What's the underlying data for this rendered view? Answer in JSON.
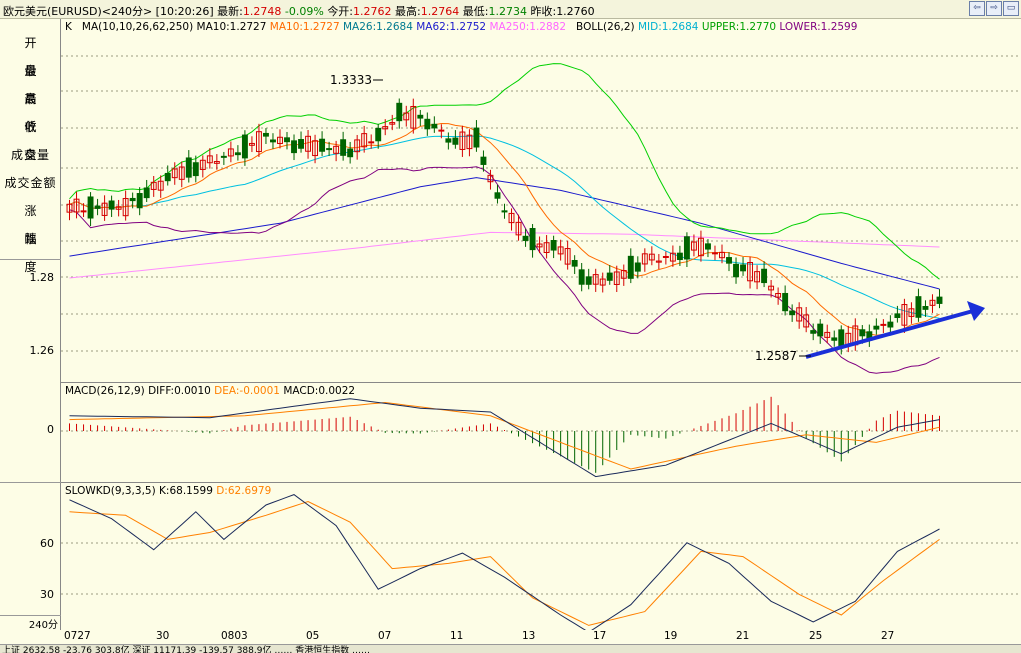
{
  "titlebar": {
    "symbol": "欧元美元(EURUSD)",
    "period": "<240分>",
    "time": "[10:20:26]",
    "latest_label": "最新:",
    "latest_value": "1.2748",
    "change": "-0.09%",
    "open_label": "今开:",
    "open_value": "1.2762",
    "high_label": "最高:",
    "high_value": "1.2764",
    "low_label": "最低:",
    "low_value": "1.2734",
    "prev_label": "昨收:",
    "prev_value": "1.2760"
  },
  "window_buttons": [
    "⇦",
    "⇨",
    "▭"
  ],
  "sidebar": {
    "items": [
      "开盘",
      "最高",
      "最低",
      "收盘",
      "成交量",
      "成交金额",
      "涨跌",
      "幅度"
    ],
    "corner_label": "240分"
  },
  "main_panel": {
    "k_label": "K",
    "ma_title": "MA(10,10,26,62,250)",
    "ma10a": "MA10:1.2727",
    "ma10b": "MA10:1.2727",
    "ma26": "MA26:1.2684",
    "ma62": "MA62:1.2752",
    "ma250": "MA250:1.2882",
    "boll_title": "BOLL(26,2)",
    "mid": "MID:1.2684",
    "upper": "UPPER:1.2770",
    "lower": "LOWER:1.2599",
    "annotation_high": "1.3333",
    "annotation_low": "1.2587",
    "y_ticks": [
      "1.28",
      "1.26"
    ]
  },
  "macd_panel": {
    "title": "MACD(26,12,9)",
    "diff": "DIFF:0.0010",
    "dea": "DEA:-0.0001",
    "macd": "MACD:0.0022",
    "y_ticks": [
      "0"
    ]
  },
  "kd_panel": {
    "title": "SLOWKD(9,3,3,5)",
    "k": "K:68.1599",
    "d": "D:62.6979",
    "y_ticks": [
      "60",
      "30"
    ]
  },
  "x_ticks": [
    "0727",
    "30",
    "0803",
    "05",
    "07",
    "11",
    "13",
    "17",
    "19",
    "21",
    "25",
    "27"
  ],
  "colors": {
    "background": "#fdfde6",
    "up_candle": "#d40000",
    "down_candle": "#006400",
    "ma10": "#ff6a00",
    "ma26": "#00c0e0",
    "ma62": "#1a1acc",
    "ma250": "#ff8cff",
    "boll_upper": "#00d000",
    "boll_lower": "#800080",
    "trend_arrow": "#1a2fd8",
    "macd_diff": "#1a2a5a",
    "macd_dea": "#ff8000",
    "k_line": "#1a2a5a",
    "d_line": "#ff8000"
  },
  "status_bar": {
    "text": "上证 2632.58   -23.76   303.8亿   深证 11171.39   -139.57   388.9亿          ……  香港恒生指数 ……"
  }
}
